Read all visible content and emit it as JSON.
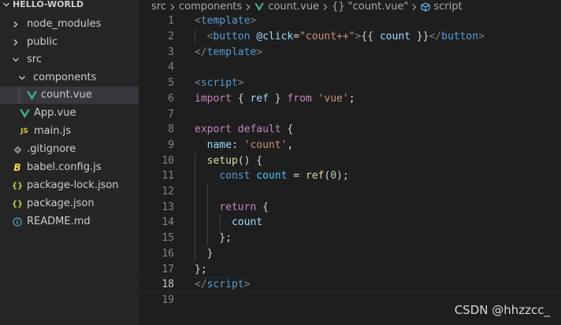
{
  "sidebar": {
    "header": "HELLO-WORLD",
    "items": [
      {
        "label": "node_modules",
        "kind": "folder",
        "state": "collapsed",
        "icon": "chevron-right-icon"
      },
      {
        "label": "public",
        "kind": "folder",
        "state": "collapsed",
        "icon": "chevron-right-icon"
      },
      {
        "label": "src",
        "kind": "folder",
        "state": "expanded",
        "icon": "chevron-down-icon"
      },
      {
        "label": "components",
        "kind": "folder",
        "state": "expanded",
        "icon": "chevron-down-icon"
      },
      {
        "label": "count.vue",
        "kind": "file",
        "icon": "vue-icon",
        "selected": true
      },
      {
        "label": "App.vue",
        "kind": "file",
        "icon": "vue-icon"
      },
      {
        "label": "main.js",
        "kind": "file",
        "icon": "js-icon",
        "glyph": "JS"
      },
      {
        "label": ".gitignore",
        "kind": "file",
        "icon": "git-icon"
      },
      {
        "label": "babel.config.js",
        "kind": "file",
        "icon": "babel-icon",
        "glyph": "B"
      },
      {
        "label": "package-lock.json",
        "kind": "file",
        "icon": "json-icon",
        "glyph": "{}"
      },
      {
        "label": "package.json",
        "kind": "file",
        "icon": "json-icon",
        "glyph": "{}"
      },
      {
        "label": "README.md",
        "kind": "file",
        "icon": "info-icon"
      }
    ]
  },
  "breadcrumb": {
    "src": "src",
    "components": "components",
    "file": "count.vue",
    "object_glyph": "{}",
    "object": "\"count.vue\"",
    "script": "script"
  },
  "editor": {
    "active_line": "18",
    "lines": [
      {
        "n": "1",
        "tokens": [
          [
            "t-punc",
            "<"
          ],
          [
            "t-tag",
            "template"
          ],
          [
            "t-punc",
            ">"
          ]
        ]
      },
      {
        "n": "2",
        "tokens": [
          [
            "t-text",
            "  "
          ],
          [
            "t-punc",
            "<"
          ],
          [
            "t-tag",
            "button"
          ],
          [
            "t-text",
            " "
          ],
          [
            "t-attr",
            "@click"
          ],
          [
            "t-text",
            "="
          ],
          [
            "t-str",
            "\"count++\""
          ],
          [
            "t-punc",
            ">"
          ],
          [
            "t-text",
            "{{ "
          ],
          [
            "t-var",
            "count"
          ],
          [
            "t-text",
            " }}"
          ],
          [
            "t-punc",
            "</"
          ],
          [
            "t-tag",
            "button"
          ],
          [
            "t-punc",
            ">"
          ]
        ]
      },
      {
        "n": "3",
        "tokens": [
          [
            "t-punc",
            "</"
          ],
          [
            "t-tag",
            "template"
          ],
          [
            "t-punc",
            ">"
          ]
        ]
      },
      {
        "n": "4",
        "tokens": []
      },
      {
        "n": "5",
        "tokens": [
          [
            "t-punc",
            "<"
          ],
          [
            "t-tag",
            "script"
          ],
          [
            "t-punc",
            ">"
          ]
        ]
      },
      {
        "n": "6",
        "tokens": [
          [
            "t-kw",
            "import"
          ],
          [
            "t-text",
            " { "
          ],
          [
            "t-var",
            "ref"
          ],
          [
            "t-text",
            " } "
          ],
          [
            "t-kw",
            "from"
          ],
          [
            "t-text",
            " "
          ],
          [
            "t-str",
            "'vue'"
          ],
          [
            "t-text",
            ";"
          ]
        ]
      },
      {
        "n": "7",
        "tokens": []
      },
      {
        "n": "8",
        "tokens": [
          [
            "t-kw",
            "export"
          ],
          [
            "t-text",
            " "
          ],
          [
            "t-kw",
            "default"
          ],
          [
            "t-text",
            " {"
          ]
        ]
      },
      {
        "n": "9",
        "tokens": [
          [
            "t-text",
            "  "
          ],
          [
            "t-var",
            "name"
          ],
          [
            "t-text",
            ": "
          ],
          [
            "t-str",
            "'count'"
          ],
          [
            "t-text",
            ","
          ]
        ]
      },
      {
        "n": "10",
        "tokens": [
          [
            "t-text",
            "  "
          ],
          [
            "t-fn",
            "setup"
          ],
          [
            "t-text",
            "() {"
          ]
        ]
      },
      {
        "n": "11",
        "tokens": [
          [
            "t-text",
            "    "
          ],
          [
            "t-decl",
            "const"
          ],
          [
            "t-text",
            " "
          ],
          [
            "t-const",
            "count"
          ],
          [
            "t-text",
            " = "
          ],
          [
            "t-fn",
            "ref"
          ],
          [
            "t-text",
            "("
          ],
          [
            "t-num",
            "0"
          ],
          [
            "t-text",
            ");"
          ]
        ]
      },
      {
        "n": "12",
        "tokens": []
      },
      {
        "n": "13",
        "tokens": [
          [
            "t-text",
            "    "
          ],
          [
            "t-kw",
            "return"
          ],
          [
            "t-text",
            " {"
          ]
        ]
      },
      {
        "n": "14",
        "tokens": [
          [
            "t-text",
            "      "
          ],
          [
            "t-var",
            "count"
          ]
        ]
      },
      {
        "n": "15",
        "tokens": [
          [
            "t-text",
            "    };"
          ]
        ]
      },
      {
        "n": "16",
        "tokens": [
          [
            "t-text",
            "  }"
          ]
        ]
      },
      {
        "n": "17",
        "tokens": [
          [
            "t-text",
            "};"
          ]
        ]
      },
      {
        "n": "18",
        "tokens": [
          [
            "t-punc",
            "</"
          ],
          [
            "t-tag",
            "script"
          ],
          [
            "t-punc",
            ">"
          ]
        ]
      },
      {
        "n": "19",
        "tokens": []
      }
    ]
  },
  "watermark": "CSDN @hhzzcc_",
  "colors": {
    "sidebar_bg": "#252526",
    "editor_bg": "#1e1e1e",
    "selected_row": "#37373d",
    "vue_green": "#41b883",
    "js_yellow": "#cbcb41",
    "babel_yellow": "#f5da55",
    "json_yellow": "#cbcb41",
    "info_blue": "#519aba"
  }
}
